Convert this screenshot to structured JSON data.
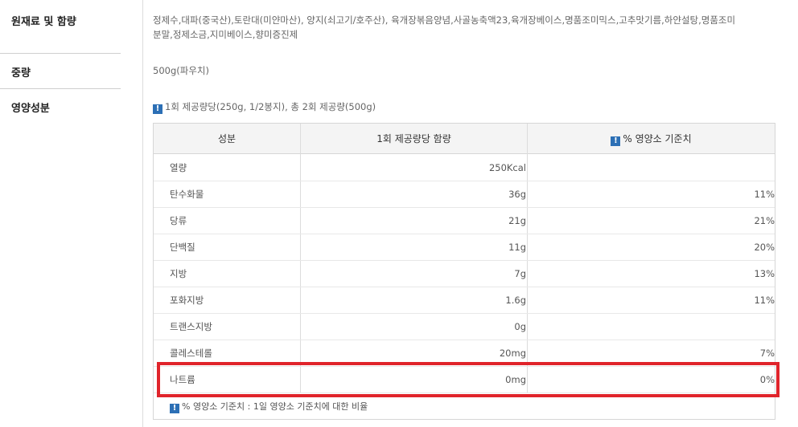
{
  "ingredients": {
    "label": "원재료 및 함량",
    "line1": "정제수,대파(중국산),토란대(미얀마산), 양지(쇠고기/호주산), 육개장볶음양념,사골농축액23,육개장베이스,명품조미믹스,고추맛기름,하얀설탕,명품조미",
    "line2": "분말,정제소금,지미베이스,향미증진제"
  },
  "weight": {
    "label": "중량",
    "value": "500g(파우치)"
  },
  "nutrition": {
    "label": "영양성분",
    "serving_info": "1회 제공량당(250g, 1/2봉지), 총 2회 제공량(500g)",
    "headers": {
      "component": "성분",
      "amount": "1회 제공량당 함량",
      "daily_value": "% 영양소 기준치"
    },
    "rows": [
      {
        "name": "열량",
        "amount": "250Kcal",
        "percent": ""
      },
      {
        "name": "탄수화물",
        "amount": "36g",
        "percent": "11%"
      },
      {
        "name": "당류",
        "amount": "21g",
        "percent": "21%"
      },
      {
        "name": "단백질",
        "amount": "11g",
        "percent": "20%"
      },
      {
        "name": "지방",
        "amount": "7g",
        "percent": "13%"
      },
      {
        "name": "포화지방",
        "amount": "1.6g",
        "percent": "11%"
      },
      {
        "name": "트랜스지방",
        "amount": "0g",
        "percent": ""
      },
      {
        "name": "콜레스테롤",
        "amount": "20mg",
        "percent": "7%"
      },
      {
        "name": "나트륨",
        "amount": "0mg",
        "percent": "0%"
      }
    ],
    "footnote": "% 영양소 기준치 : 1일 영양소 기준치에 대한 비율"
  },
  "icons": {
    "info": "info-icon"
  },
  "colors": {
    "highlight": "#e0242b",
    "info_icon": "#2c6fb5"
  }
}
